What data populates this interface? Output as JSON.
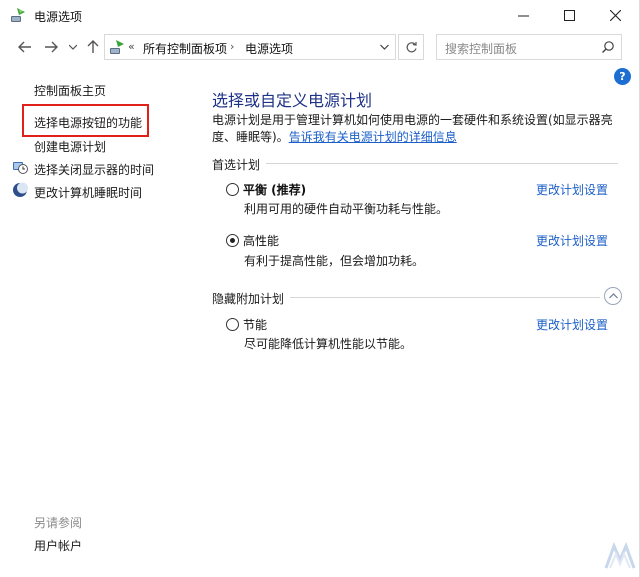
{
  "window": {
    "title": "电源选项",
    "minimize_glyph": "—",
    "maximize_glyph": "☐",
    "close_glyph": "✕"
  },
  "nav": {
    "breadcrumb_overflow": "«",
    "breadcrumb": [
      "所有控制面板项",
      "电源选项"
    ],
    "breadcrumb_sep": "›",
    "search_placeholder": "搜索控制面板"
  },
  "sidebar": {
    "items": [
      {
        "label": "控制面板主页"
      },
      {
        "label": "选择电源按钮的功能"
      },
      {
        "label": "创建电源计划"
      },
      {
        "label": "选择关闭显示器的时间"
      },
      {
        "label": "更改计算机睡眠时间"
      }
    ],
    "see_also_label": "另请参阅",
    "see_also_items": [
      {
        "label": "用户帐户"
      }
    ]
  },
  "main": {
    "title": "选择或自定义电源计划",
    "description": "电源计划是用于管理计算机如何使用电源的一套硬件和系统设置(如显示器亮度、睡眠等)。",
    "description_link": "告诉我有关电源计划的详细信息",
    "preferred_heading": "首选计划",
    "hidden_heading": "隐藏附加计划",
    "plans": [
      {
        "name": "平衡 (推荐)",
        "desc": "利用可用的硬件自动平衡功耗与性能。",
        "link": "更改计划设置",
        "selected": false
      },
      {
        "name": "高性能",
        "desc": "有利于提高性能，但会增加功耗。",
        "link": "更改计划设置",
        "selected": true
      },
      {
        "name": "节能",
        "desc": "尽可能降低计算机性能以节能。",
        "link": "更改计划设置",
        "selected": false
      }
    ]
  },
  "colors": {
    "accent": "#1c5fc8",
    "title": "#1e3287",
    "highlight": "#e0201b"
  }
}
